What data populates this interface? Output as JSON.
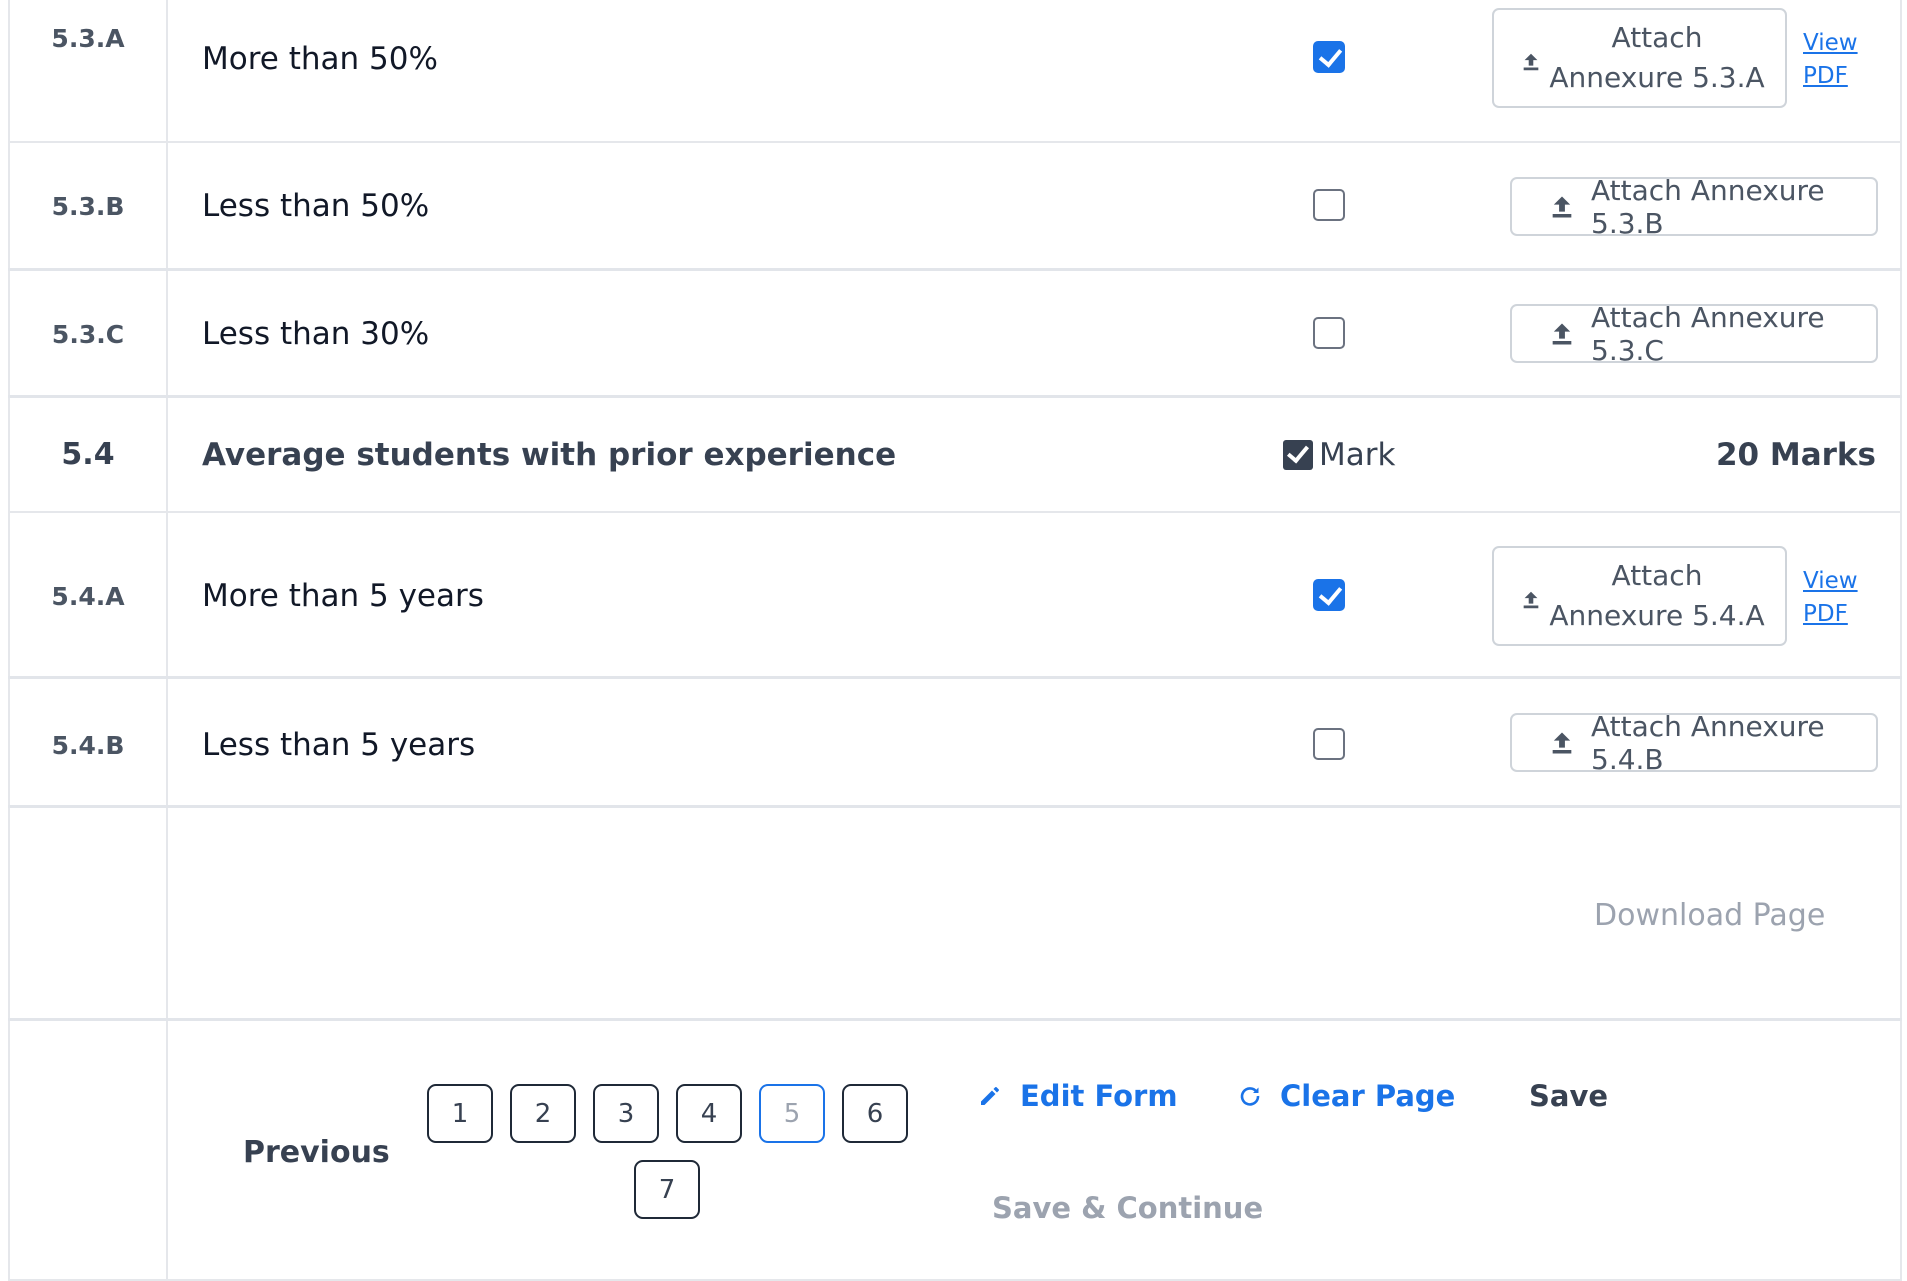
{
  "rows": [
    {
      "code": "5.3.A",
      "label": "More than 50%",
      "checked": true,
      "attach_line1": "Attach",
      "attach_line2": "Annexure 5.3.A",
      "view_line1": "View",
      "view_line2": "PDF"
    },
    {
      "code": "5.3.B",
      "label": "Less than 50%",
      "checked": false,
      "attach": "Attach Annexure 5.3.B"
    },
    {
      "code": "5.3.C",
      "label": "Less than 30%",
      "checked": false,
      "attach": "Attach Annexure 5.3.C"
    },
    {
      "code": "5.4",
      "label": "Average students with prior experience",
      "mark_label": "Mark",
      "marks": "20 Marks"
    },
    {
      "code": "5.4.A",
      "label": "More than 5 years",
      "checked": true,
      "attach_line1": "Attach",
      "attach_line2": "Annexure 5.4.A",
      "view_line1": "View",
      "view_line2": "PDF"
    },
    {
      "code": "5.4.B",
      "label": "Less than 5 years",
      "checked": false,
      "attach": "Attach Annexure 5.4.B"
    }
  ],
  "download_label": "Download Page",
  "footer": {
    "previous": "Previous",
    "pages": [
      "1",
      "2",
      "3",
      "4",
      "5",
      "6",
      "7"
    ],
    "active_page": "5",
    "edit_form": "Edit Form",
    "clear_page": "Clear Page",
    "save": "Save",
    "save_continue": "Save & Continue"
  },
  "colors": {
    "accent": "#1a73e8",
    "border": "#e5e7eb",
    "muted": "#9ca3af"
  }
}
